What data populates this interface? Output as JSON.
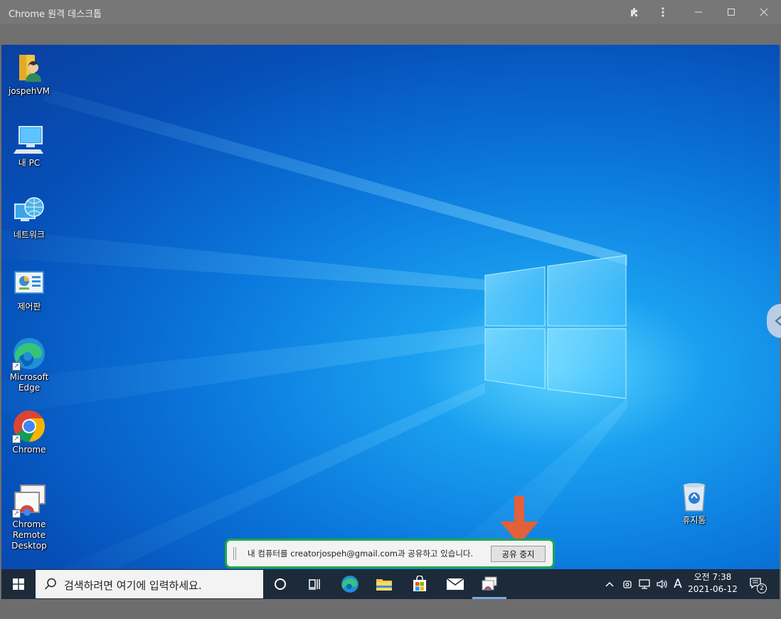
{
  "window": {
    "title": "Chrome 원격 데스크톱"
  },
  "desktop": {
    "icons": [
      {
        "label": "jospehVM"
      },
      {
        "label": "내 PC"
      },
      {
        "label": "네트워크"
      },
      {
        "label": "제어판"
      },
      {
        "label": "Microsoft Edge"
      },
      {
        "label": "Chrome"
      },
      {
        "label": "Chrome Remote Desktop"
      },
      {
        "label": "휴지통"
      }
    ]
  },
  "share_bar": {
    "message": "내 컴퓨터를 creatorjospeh@gmail.com과 공유하고 있습니다.",
    "stop_label": "공유 중지"
  },
  "taskbar": {
    "search_placeholder": "검색하려면 여기에 입력하세요.",
    "ime_indicator": "A",
    "time": "오전 7:38",
    "date": "2021-06-12",
    "notification_count": "2"
  },
  "colors": {
    "accent_green": "#1fa84a",
    "arrow_orange": "#e2603a",
    "taskbar": "#1d2a3a"
  }
}
